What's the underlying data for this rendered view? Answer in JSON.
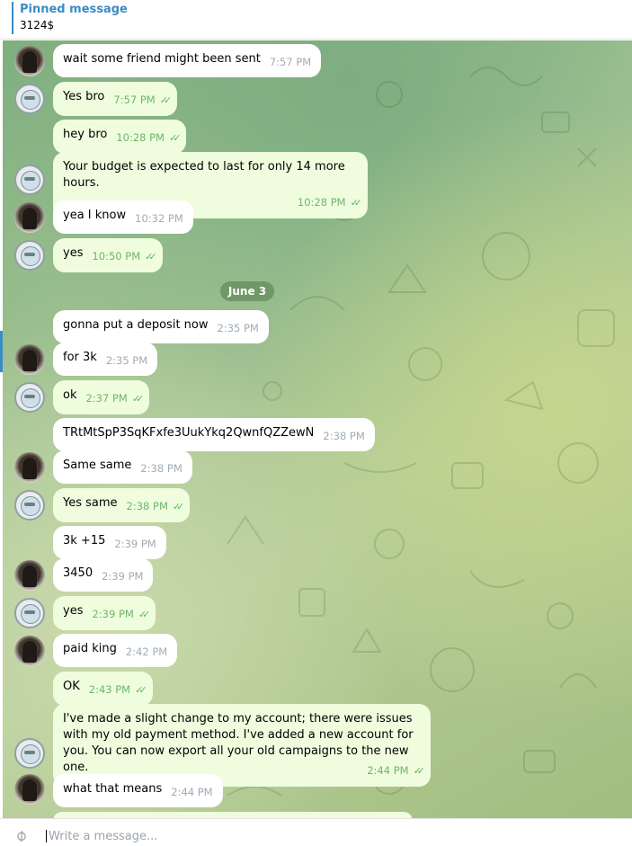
{
  "pinned": {
    "title": "Pinned message",
    "text": "3124$"
  },
  "date_separator": "June 3",
  "input": {
    "placeholder": "Write a message..."
  },
  "messages": [
    {
      "text": "wait some friend might been sent",
      "time": "7:57 PM"
    },
    {
      "text": "Yes bro",
      "time": "7:57 PM"
    },
    {
      "text": "hey bro",
      "time": "10:28 PM"
    },
    {
      "text": "Your budget is expected to last for only 14 more hours.",
      "time": "10:28 PM"
    },
    {
      "text": "yea I know",
      "time": "10:32 PM"
    },
    {
      "text": "yes",
      "time": "10:50 PM"
    },
    {
      "text": "gonna put a deposit now",
      "time": "2:35 PM"
    },
    {
      "text": "for 3k",
      "time": "2:35 PM"
    },
    {
      "text": "ok",
      "time": "2:37 PM"
    },
    {
      "text": "TRtMtSpP3SqKFxfe3UukYkq2QwnfQZZewN",
      "time": "2:38 PM"
    },
    {
      "text": "Same same",
      "time": "2:38 PM"
    },
    {
      "text": "Yes same",
      "time": "2:38 PM"
    },
    {
      "text": "3k +15",
      "time": "2:39 PM"
    },
    {
      "text": "3450",
      "time": "2:39 PM"
    },
    {
      "text": "yes",
      "time": "2:39 PM"
    },
    {
      "text": "paid king",
      "time": "2:42 PM"
    },
    {
      "text": "OK",
      "time": "2:43 PM"
    },
    {
      "text": "I've made a slight change to my account; there were issues with my old payment method. I've added a new account for you. You can now export all your old campaigns to the new one.",
      "time": "2:44 PM"
    },
    {
      "text": "what that means",
      "time": "2:44 PM"
    }
  ]
}
